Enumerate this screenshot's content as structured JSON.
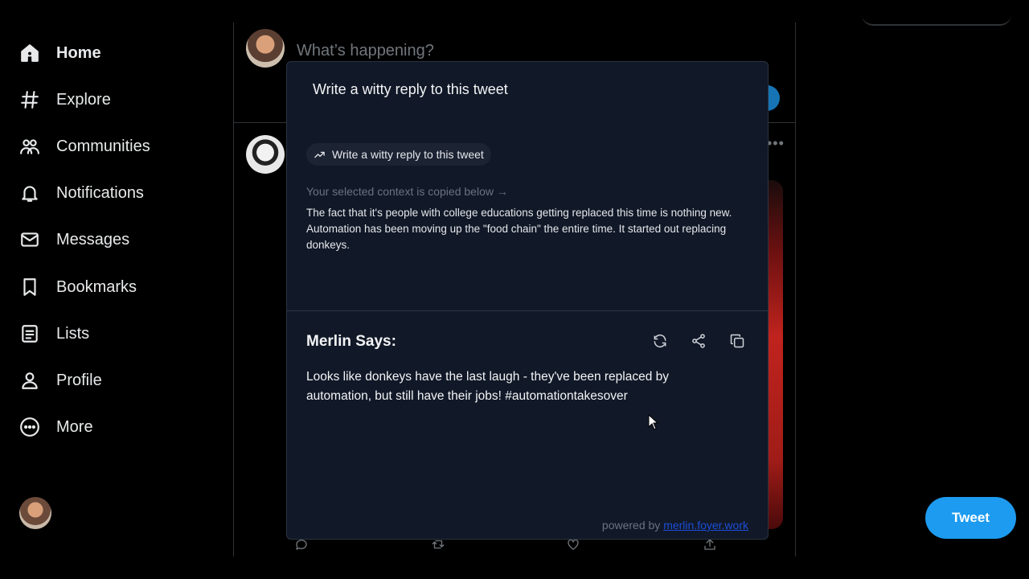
{
  "nav": {
    "items": [
      {
        "label": "Home",
        "icon": "home-icon",
        "active": true
      },
      {
        "label": "Explore",
        "icon": "hashtag-icon"
      },
      {
        "label": "Communities",
        "icon": "communities-icon"
      },
      {
        "label": "Notifications",
        "icon": "bell-icon"
      },
      {
        "label": "Messages",
        "icon": "envelope-icon"
      },
      {
        "label": "Bookmarks",
        "icon": "bookmark-icon"
      },
      {
        "label": "Lists",
        "icon": "list-icon"
      },
      {
        "label": "Profile",
        "icon": "person-icon"
      },
      {
        "label": "More",
        "icon": "more-circle-icon"
      }
    ]
  },
  "compose": {
    "placeholder": "What’s happening?"
  },
  "tweet_button": "Tweet",
  "merlin": {
    "prompt": "Write a witty reply to this tweet",
    "chip_label": "Write a witty reply to this tweet",
    "context_label": "Your selected context is copied below →",
    "context_text": "The fact that it's people with college educations getting replaced this time is nothing new. Automation has been moving up the \"food chain\" the entire time. It started out replacing donkeys.",
    "response_title": "Merlin Says:",
    "response_text": "Looks like donkeys have the last laugh - they've been replaced by automation, but still have their jobs! #automationtakesover",
    "powered_by_label": "powered by",
    "powered_by_link": "merlin.foyer.work"
  },
  "colors": {
    "accent": "#1d9bf0",
    "modal_bg": "#111827",
    "background": "#000000"
  }
}
